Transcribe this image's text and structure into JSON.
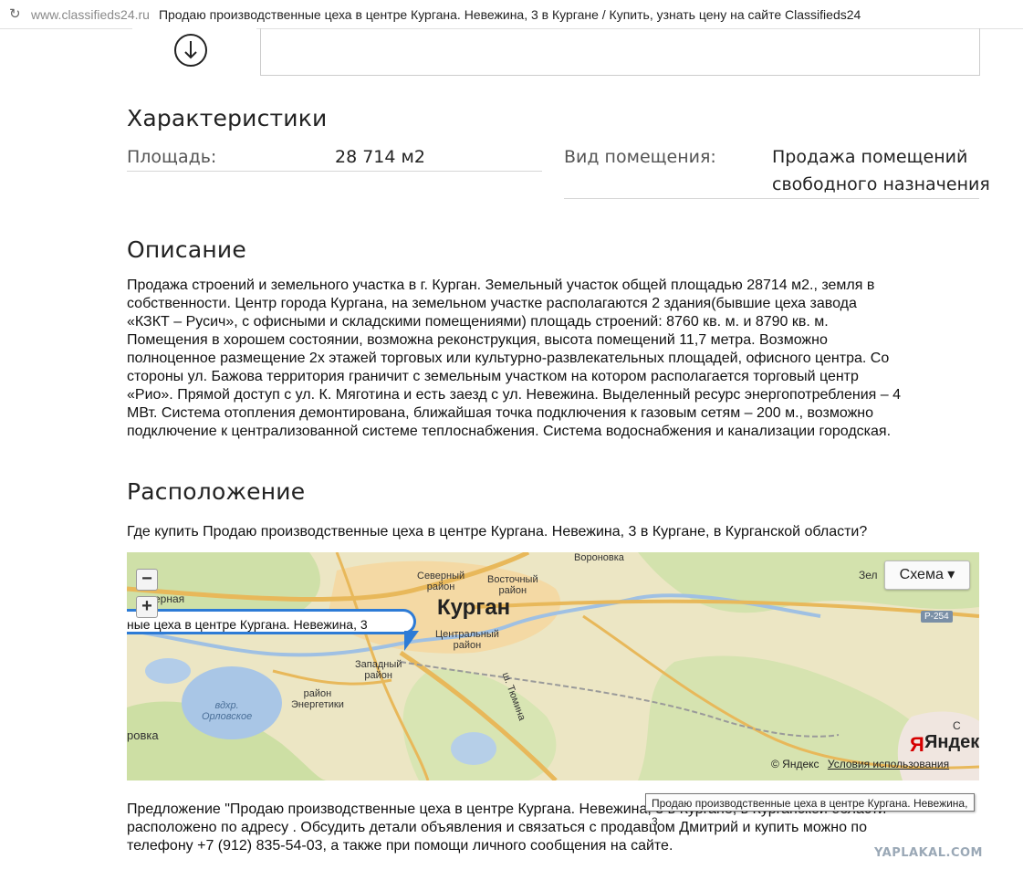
{
  "browser": {
    "url": "www.classifieds24.ru",
    "title": "Продаю производственные цеха в центре Кургана. Невежина, 3 в Кургане / Купить, узнать цену на сайте Classifieds24"
  },
  "characteristics": {
    "heading": "Характеристики",
    "area_label": "Площадь:",
    "area_value": "28 714 м2",
    "type_label": "Вид помещения:",
    "type_value_line1": "Продажа помещений",
    "type_value_line2": "свободного назначения"
  },
  "description": {
    "heading": "Описание",
    "lines": [
      "Продажа строений и земельного участка в г. Курган. Земельный участок общей площадью 28714 м2., земля в",
      "собственности. Центр города Кургана, на земельном участке располагаются 2 здания(бывшие цеха завода",
      "«КЗКТ – Русич», с офисными и складскими помещениями) площадь строений: 8760 кв. м. и 8790 кв. м.",
      "Помещения в хорошем состоянии, возможна реконструкция, высота помещений 11,7 метра. Возможно",
      "полноценное размещение 2х этажей торговых или культурно-развлекательных площадей, офисного центра. Со",
      "стороны ул. Бажова территория граничит с земельным участком на котором располагается торговый центр",
      "«Рио». Прямой доступ с ул. К. Мяготина и есть заезд с ул. Невежина. Выделенный ресурс энергопотребления – 4",
      "МВт. Система отопления демонтирована, ближайшая точка подключения к газовым сетям – 200 м., возможно",
      "подключение к централизованной системе теплоснабжения. Система водоснабжения и канализации городская."
    ]
  },
  "location": {
    "heading": "Расположение",
    "question": "Где купить Продаю производственные цеха в центре Кургана. Невежина, 3 в Кургане, в Курганской области?"
  },
  "map": {
    "zoom_out": "−",
    "zoom_in": "+",
    "layer_button": "Схема ▾",
    "balloon": "ные цеха в центре Кургана. Невежина, 3",
    "city": "Курган",
    "labels": {
      "severny": "Северный",
      "severny2": "район",
      "vostochny": "Восточный",
      "vostochny2": "район",
      "centralny": "Центральный",
      "centralny2": "район",
      "zapadny": "Западный",
      "zapadny2": "район",
      "energetiki": "район",
      "energetiki2": "Энергетики",
      "lake": "вдхр.",
      "lake2": "Орловское",
      "orlovka": "ровка",
      "voronovka": "Вороновка",
      "zele": "Зел",
      "tyumina": "ш. Тюмина",
      "road": "Р-254",
      "nernaya": "ерная",
      "edge_c": "С"
    },
    "brand": "Яндекс",
    "copyright": "© Яндекс",
    "terms": "Условия использования"
  },
  "tooltip": "Продаю производственные цеха в центре Кургана. Невежина, 3",
  "offer": {
    "line1": "Предложение \"Продаю производственные цеха в центре Кургана. Невежина, 3 в Кургане, в Курганской области\"",
    "line2": "расположено по адресу . Обсудить детали объявления и связаться с продавцом Дмитрий и купить можно по",
    "line3": "телефону +7 (912) 835-54-03, а также при помощи личного сообщения на сайте."
  },
  "watermark": "YAPLAKAL.COM"
}
